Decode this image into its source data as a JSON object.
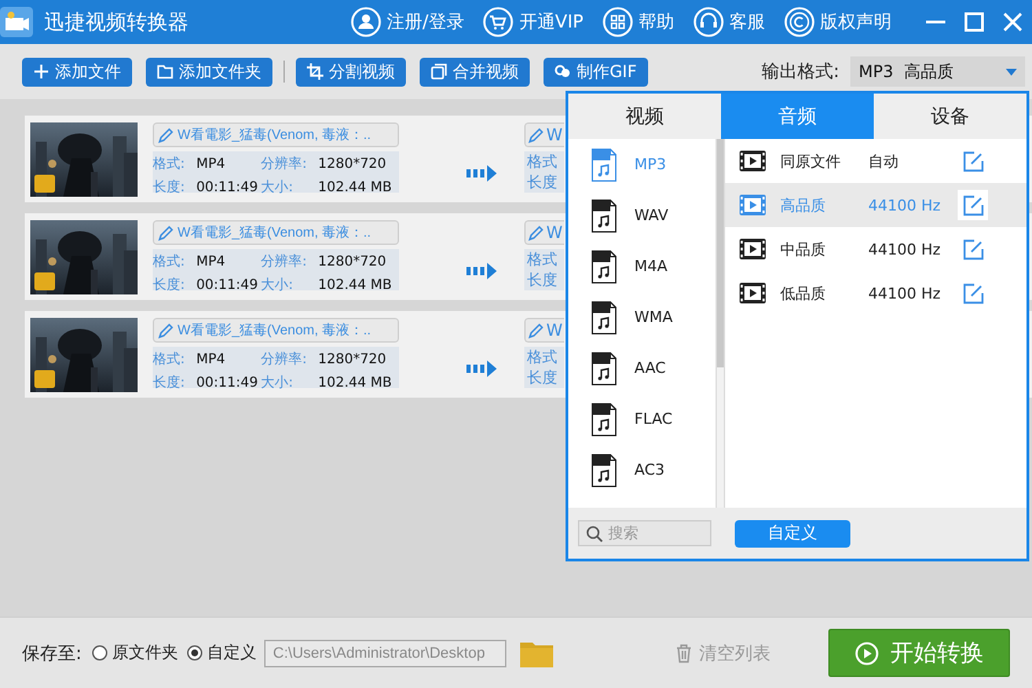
{
  "window": {
    "title": "迅捷视频转换器",
    "header_links": [
      {
        "label": "注册/登录"
      },
      {
        "label": "开通VIP"
      },
      {
        "label": "帮助"
      },
      {
        "label": "客服"
      },
      {
        "label": "版权声明"
      }
    ]
  },
  "toolbar": {
    "buttons": [
      {
        "label": "添加文件"
      },
      {
        "label": "添加文件夹"
      },
      {
        "label": "分割视频"
      },
      {
        "label": "合并视频"
      },
      {
        "label": "制作GIF"
      }
    ],
    "output_format": {
      "label": "输出格式:",
      "value": "MP3  高品质"
    }
  },
  "files": [
    {
      "name": "W看電影_猛毒(Venom, 毒液：..",
      "format_label": "格式:",
      "format": "MP4",
      "resolution_label": "分辨率:",
      "resolution": "1280*720",
      "duration_label": "长度:",
      "duration": "00:11:49",
      "size_label": "大小:",
      "size": "102.44 MB",
      "output_name": "W",
      "output_format_label": "格式",
      "output_duration_label": "长度"
    },
    {
      "name": "W看電影_猛毒(Venom, 毒液：..",
      "format_label": "格式:",
      "format": "MP4",
      "resolution_label": "分辨率:",
      "resolution": "1280*720",
      "duration_label": "长度:",
      "duration": "00:11:49",
      "size_label": "大小:",
      "size": "102.44 MB",
      "output_name": "W",
      "output_format_label": "格式",
      "output_duration_label": "长度"
    },
    {
      "name": "W看電影_猛毒(Venom, 毒液：..",
      "format_label": "格式:",
      "format": "MP4",
      "resolution_label": "分辨率:",
      "resolution": "1280*720",
      "duration_label": "长度:",
      "duration": "00:11:49",
      "size_label": "大小:",
      "size": "102.44 MB",
      "output_name": "W",
      "output_format_label": "格式",
      "output_duration_label": "长度"
    }
  ],
  "popup": {
    "tabs": [
      {
        "label": "视频",
        "selected": false
      },
      {
        "label": "音频",
        "selected": true
      },
      {
        "label": "设备",
        "selected": false
      }
    ],
    "formats": [
      {
        "label": "MP3",
        "selected": true
      },
      {
        "label": "WAV",
        "selected": false
      },
      {
        "label": "M4A",
        "selected": false
      },
      {
        "label": "WMA",
        "selected": false
      },
      {
        "label": "AAC",
        "selected": false
      },
      {
        "label": "FLAC",
        "selected": false
      },
      {
        "label": "AC3",
        "selected": false
      }
    ],
    "presets": [
      {
        "name": "同原文件",
        "rate": "自动",
        "selected": false
      },
      {
        "name": "高品质",
        "rate": "44100 Hz",
        "selected": true
      },
      {
        "name": "中品质",
        "rate": "44100 Hz",
        "selected": false
      },
      {
        "name": "低品质",
        "rate": "44100 Hz",
        "selected": false
      }
    ],
    "search": {
      "placeholder": "搜索"
    },
    "custom_button": "自定义"
  },
  "bottom_bar": {
    "save_label": "保存至:",
    "save_options": [
      {
        "label": "原文件夹",
        "selected": false
      },
      {
        "label": "自定义",
        "selected": true
      }
    ],
    "path": "C:\\Users\\Administrator\\Desktop",
    "clear_button": "清空列表",
    "start_button": "开始转换"
  }
}
